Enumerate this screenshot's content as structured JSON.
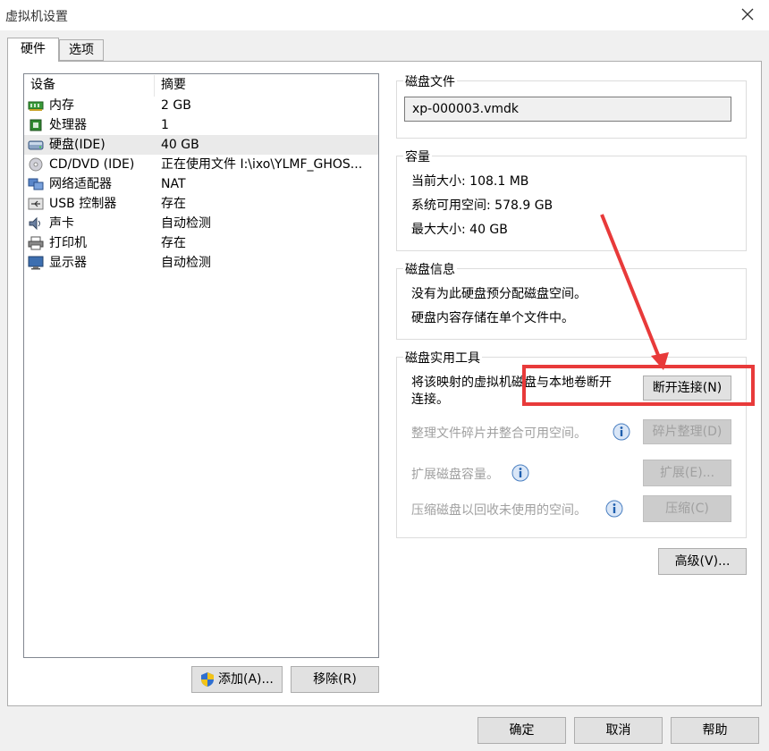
{
  "window": {
    "title": "虚拟机设置"
  },
  "tabs": [
    {
      "label": "硬件"
    },
    {
      "label": "选项"
    }
  ],
  "devices": {
    "header": {
      "device": "设备",
      "summary": "摘要"
    },
    "rows": [
      {
        "device": "内存",
        "summary": "2 GB",
        "icon": "memory-icon"
      },
      {
        "device": "处理器",
        "summary": "1",
        "icon": "processor-icon"
      },
      {
        "device": "硬盘(IDE)",
        "summary": "40 GB",
        "icon": "hard-disk-icon"
      },
      {
        "device": "CD/DVD (IDE)",
        "summary": "正在使用文件 I:\\ixo\\YLMF_GHOS...",
        "icon": "cd-dvd-icon"
      },
      {
        "device": "网络适配器",
        "summary": "NAT",
        "icon": "network-adapter-icon"
      },
      {
        "device": "USB 控制器",
        "summary": "存在",
        "icon": "usb-icon"
      },
      {
        "device": "声卡",
        "summary": "自动检测",
        "icon": "sound-icon"
      },
      {
        "device": "打印机",
        "summary": "存在",
        "icon": "printer-icon"
      },
      {
        "device": "显示器",
        "summary": "自动检测",
        "icon": "display-icon"
      }
    ],
    "add_label": "添加(A)...",
    "remove_label": "移除(R)"
  },
  "disk_file": {
    "legend": "磁盘文件",
    "value": "xp-000003.vmdk"
  },
  "capacity": {
    "legend": "容量",
    "current": "当前大小: 108.1 MB",
    "free": "系统可用空间: 578.9 GB",
    "max": "最大大小: 40 GB"
  },
  "disk_info": {
    "legend": "磁盘信息",
    "line1": "没有为此硬盘预分配磁盘空间。",
    "line2": "硬盘内容存储在单个文件中。"
  },
  "utilities": {
    "legend": "磁盘实用工具",
    "disconnect_text_1": "将该映射的虚拟机磁盘与本地卷断开",
    "disconnect_text_2": "连接。",
    "disconnect_btn": "断开连接(N)",
    "defrag_text": "整理文件碎片并整合可用空间。",
    "defrag_btn": "碎片整理(D)",
    "expand_text": "扩展磁盘容量。",
    "expand_btn": "扩展(E)...",
    "compact_text": "压缩磁盘以回收未使用的空间。",
    "compact_btn": "压缩(C)"
  },
  "advanced_btn": "高级(V)...",
  "footer": {
    "ok": "确定",
    "cancel": "取消",
    "help": "帮助"
  },
  "colors": {
    "highlight": "#e83a3a",
    "selected_row": "#eaeaea"
  }
}
